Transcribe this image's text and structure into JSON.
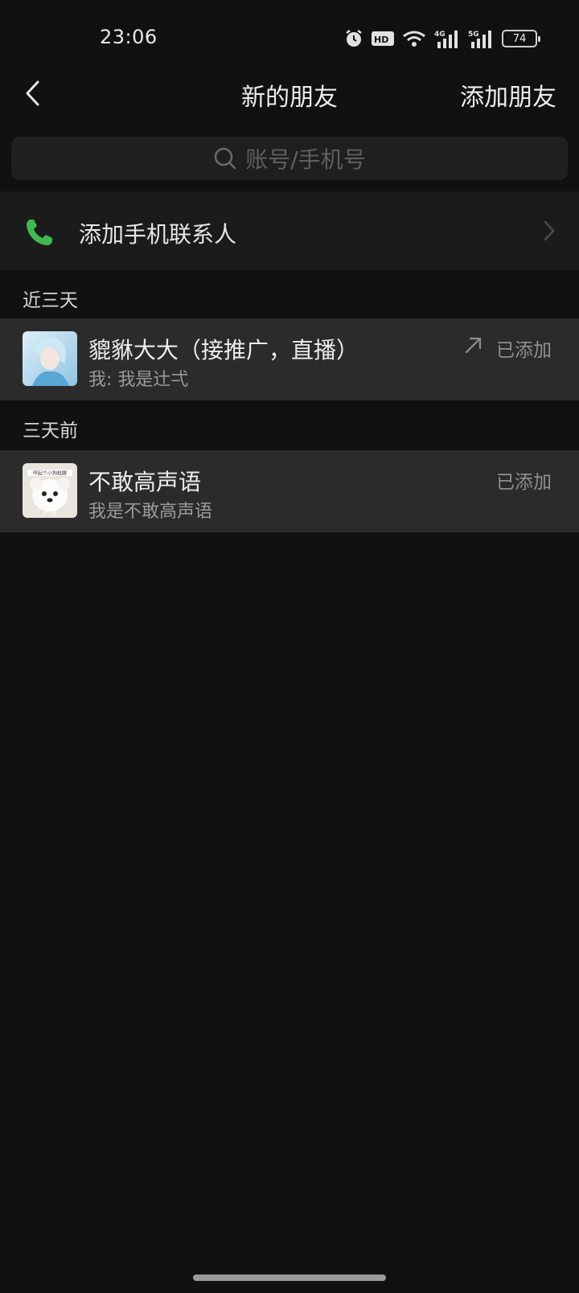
{
  "status_bar": {
    "time": "23:06",
    "battery": "74"
  },
  "nav": {
    "title": "新的朋友",
    "action_label": "添加朋友"
  },
  "search": {
    "placeholder": "账号/手机号"
  },
  "phone_contacts": {
    "label": "添加手机联系人",
    "icon_color": "#3fb950"
  },
  "sections": [
    {
      "title": "近三天",
      "friends": [
        {
          "name": "貔貅大大（接推广，直播）",
          "message": "我: 我是辻弌",
          "status": "已添加",
          "shared": true
        }
      ]
    },
    {
      "title": "三天前",
      "friends": [
        {
          "name": "不敢高声语",
          "message": "我是不敢高声语",
          "status": "已添加",
          "shared": false
        }
      ]
    }
  ],
  "avatar_texts": {
    "dog_top": "哼起个小狗批腰",
    "dog_bottom": "严肃"
  }
}
